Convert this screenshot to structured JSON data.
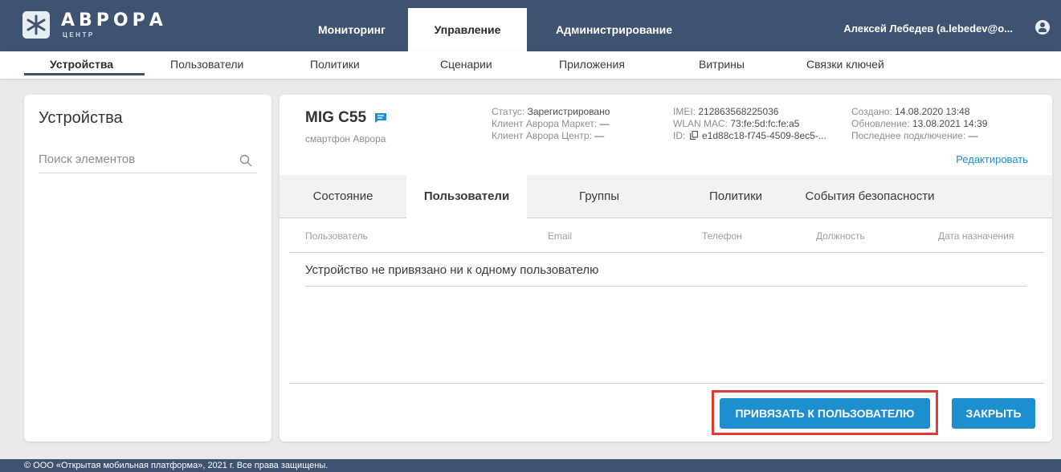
{
  "logo": {
    "title": "АВРОРА",
    "subtitle": "ЦЕНТР"
  },
  "topnav": {
    "tabs": [
      "Мониторинг",
      "Управление",
      "Администрирование"
    ],
    "active": "Управление"
  },
  "user": {
    "name": "Алексей Лебедев (a.lebedev@o..."
  },
  "subnav": {
    "tabs": [
      "Устройства",
      "Пользователи",
      "Политики",
      "Сценарии",
      "Приложения",
      "Витрины",
      "Связки ключей"
    ],
    "active": "Устройства"
  },
  "left": {
    "title": "Устройства",
    "search_placeholder": "Поиск элементов"
  },
  "device": {
    "name": "MIG C55",
    "type": "смартфон Аврора",
    "status_label": "Статус:",
    "status_value": "Зарегистрировано",
    "market_label": "Клиент Аврора Маркет:",
    "market_value": "—",
    "center_label": "Клиент Аврора Центр:",
    "center_value": "—",
    "imei_label": "IMEI:",
    "imei_value": "212863568225036",
    "wlan_label": "WLAN MAC:",
    "wlan_value": "73:fe:5d:fc:fe:a5",
    "id_label": "ID:",
    "id_value": "e1d88c18-f745-4509-8ec5-...",
    "created_label": "Создано:",
    "created_value": "14.08.2020 13:48",
    "updated_label": "Обновление:",
    "updated_value": "13.08.2021 14:39",
    "last_conn_label": "Последнее подключение:",
    "last_conn_value": "—",
    "edit_label": "Редактировать"
  },
  "detail_tabs": {
    "tabs": [
      "Состояние",
      "Пользователи",
      "Группы",
      "Политики",
      "События безопасности"
    ],
    "active": "Пользователи"
  },
  "table": {
    "columns": [
      "Пользователь",
      "Email",
      "Телефон",
      "Должность",
      "Дата назначения"
    ],
    "empty_message": "Устройство не привязано ни к одному пользователю"
  },
  "actions": {
    "bind_label": "ПРИВЯЗАТЬ К ПОЛЬЗОВАТЕЛЮ",
    "close_label": "ЗАКРЫТЬ"
  },
  "footer": {
    "text": "© ООО «Открытая мобильная платформа», 2021 г. Все права защищены."
  },
  "colors": {
    "header": "#3d5370",
    "accent": "#1d8fcf",
    "highlight": "#e53935",
    "link": "#1a8fd6"
  },
  "icons": [
    "aurora-logo-icon",
    "user-avatar-icon",
    "search-icon",
    "message-icon",
    "copy-icon"
  ]
}
